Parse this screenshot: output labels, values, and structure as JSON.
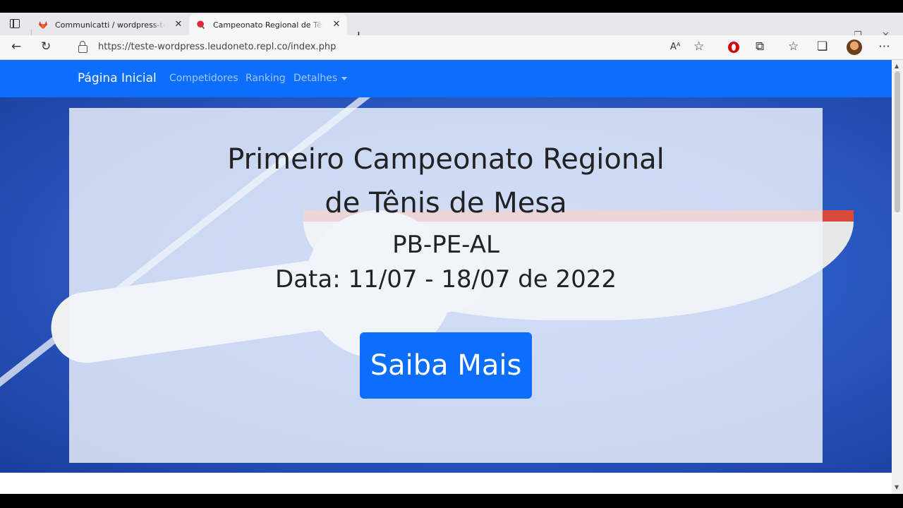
{
  "browser": {
    "tabs": [
      {
        "title": "Communicatti / wordpress-test"
      },
      {
        "title": "Campeonato Regional de Tênis de Mesa"
      }
    ],
    "url": "https://teste-wordpress.leudoneto.repl.co/index.php"
  },
  "navbar": {
    "brand": "Página Inicial",
    "links": [
      "Competidores",
      "Ranking",
      "Detalhes"
    ]
  },
  "hero": {
    "title_line1": "Primeiro Campeonato Regional",
    "title_line2": "de Tênis de Mesa",
    "subtitle": "PB-PE-AL",
    "date": "Data: 11/07 - 18/07 de 2022",
    "cta_label": "Saiba Mais"
  },
  "colors": {
    "primary": "#0d6efd",
    "hero_bg": "#2d5cc7"
  },
  "icons": [
    "tab-actions-icon",
    "gitlab-icon",
    "favicon-red-icon",
    "close-icon",
    "plus-icon",
    "back-icon",
    "refresh-icon",
    "lock-icon",
    "read-aloud-icon",
    "favorite-add-icon",
    "opera-icon",
    "extensions-icon",
    "favorites-icon",
    "collections-icon",
    "more-icon"
  ]
}
